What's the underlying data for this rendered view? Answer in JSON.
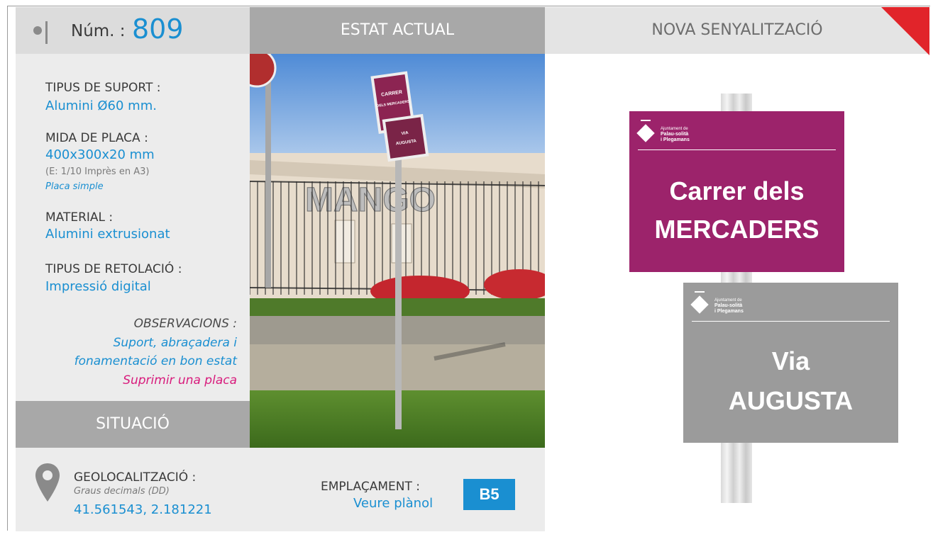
{
  "header": {
    "num_label": "Núm. :",
    "num_value": "809",
    "current_state": "ESTAT ACTUAL",
    "new_signage": "NOVA SENYALITZACIÓ"
  },
  "specs": {
    "support_label": "TIPUS DE SUPORT :",
    "support_value": "Alumini Ø60 mm.",
    "plate_size_label": "MIDA DE PLACA :",
    "plate_size_value": "400x300x20 mm",
    "plate_scale_note": "(E: 1/10 Imprès en A3)",
    "plate_type": "Placa simple",
    "material_label": "MATERIAL :",
    "material_value": "Alumini extrusionat",
    "lettering_label": "TIPUS DE RETOLACIÓ :",
    "lettering_value": "Impressió digital",
    "observations_label": "OBSERVACIONS :",
    "observations_line1": "Suport, abraçadera i",
    "observations_line2": "fonamentació en bon estat",
    "observations_action": "Suprimir una placa"
  },
  "situation": {
    "title": "SITUACIÓ",
    "geo_label": "GEOLOCALITZACIÓ :",
    "geo_format": "Graus decimals (DD)",
    "geo_value": "41.561543, 2.181221",
    "location_label": "EMPLAÇAMENT :",
    "location_link": "Veure plànol",
    "location_code": "B5"
  },
  "photo": {
    "building_text": "MANGO",
    "old_sign_top_line1": "CARRER",
    "old_sign_top_line2": "DELS MERCADERS",
    "old_sign_bottom_line1": "VIA",
    "old_sign_bottom_line2": "AUGUSTA"
  },
  "signs": [
    {
      "line1": "Carrer dels",
      "line2": "MERCADERS",
      "color": "#9c236b",
      "logo_line1": "Ajuntament de",
      "logo_line2": "Palau-solità",
      "logo_line3": "i Plegamans"
    },
    {
      "line1": "Via",
      "line2": "AUGUSTA",
      "color": "#9b9b9b",
      "logo_line1": "Ajuntament de",
      "logo_line2": "Palau-solità",
      "logo_line3": "i Plegamans"
    }
  ],
  "colors": {
    "accent_blue": "#1a8fd1",
    "accent_magenta": "#d81b7c",
    "corner_red": "#e1242a"
  }
}
